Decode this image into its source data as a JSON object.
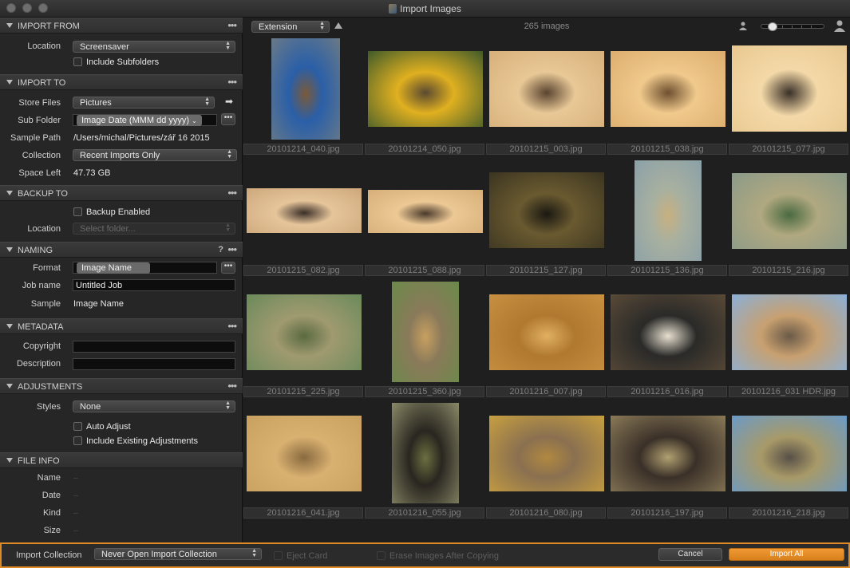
{
  "window": {
    "title": "Import Images"
  },
  "sidebar": {
    "import_from": {
      "header": "IMPORT FROM",
      "location_label": "Location",
      "location_value": "Screensaver",
      "include_subfolders": "Include Subfolders"
    },
    "import_to": {
      "header": "IMPORT TO",
      "store_files_label": "Store Files",
      "store_files_value": "Pictures",
      "sub_folder_label": "Sub Folder",
      "sub_folder_value": "Image Date (MMM dd yyyy)",
      "sample_path_label": "Sample Path",
      "sample_path_value": "/Users/michal/Pictures/zář 16 2015",
      "collection_label": "Collection",
      "collection_value": "Recent Imports Only",
      "space_left_label": "Space Left",
      "space_left_value": "47.73 GB"
    },
    "backup_to": {
      "header": "BACKUP TO",
      "backup_enabled": "Backup Enabled",
      "location_label": "Location",
      "location_placeholder": "Select folder..."
    },
    "naming": {
      "header": "NAMING",
      "help": "?",
      "format_label": "Format",
      "format_token": "Image Name",
      "job_name_label": "Job name",
      "job_name_value": "Untitled Job",
      "sample_label": "Sample",
      "sample_value": "Image Name"
    },
    "metadata": {
      "header": "METADATA",
      "copyright_label": "Copyright",
      "description_label": "Description"
    },
    "adjustments": {
      "header": "ADJUSTMENTS",
      "styles_label": "Styles",
      "styles_value": "None",
      "auto_adjust": "Auto Adjust",
      "include_existing": "Include Existing Adjustments"
    },
    "file_info": {
      "header": "FILE INFO",
      "name_label": "Name",
      "date_label": "Date",
      "kind_label": "Kind",
      "size_label": "Size"
    }
  },
  "browser": {
    "sort_value": "Extension",
    "count": "265 images",
    "thumbnails": [
      {
        "name": "20101214_040.jpg",
        "palette": [
          "#6b7a86",
          "#2a5fa8",
          "#7a5a3a"
        ]
      },
      {
        "name": "20101214_050.jpg",
        "palette": [
          "#3f5a2a",
          "#e0b020",
          "#5a4a30"
        ]
      },
      {
        "name": "20101215_003.jpg",
        "palette": [
          "#d7b07a",
          "#e8c896",
          "#5a4430"
        ]
      },
      {
        "name": "20101215_038.jpg",
        "palette": [
          "#dcae6e",
          "#f0c98c",
          "#6e5030"
        ]
      },
      {
        "name": "20101215_077.jpg",
        "palette": [
          "#e8c890",
          "#f4d9a8",
          "#3a3028"
        ]
      },
      {
        "name": "20101215_082.jpg",
        "palette": [
          "#cda77c",
          "#e6c59a",
          "#3a2e28"
        ]
      },
      {
        "name": "20101215_088.jpg",
        "palette": [
          "#d6ae78",
          "#ecc894",
          "#4a3a2c"
        ]
      },
      {
        "name": "20101215_127.jpg",
        "palette": [
          "#3a3420",
          "#6a5a30",
          "#1a1812"
        ]
      },
      {
        "name": "20101215_136.jpg",
        "palette": [
          "#8aa0a8",
          "#a8b0a0",
          "#c8b080"
        ]
      },
      {
        "name": "20101215_216.jpg",
        "palette": [
          "#8a9a88",
          "#b0a880",
          "#4a6a40"
        ]
      },
      {
        "name": "20101215_225.jpg",
        "palette": [
          "#6a8a5a",
          "#a09a70",
          "#5a6a40"
        ]
      },
      {
        "name": "20101215_360.jpg",
        "palette": [
          "#6a8a4a",
          "#8a7a5a",
          "#c8a060"
        ]
      },
      {
        "name": "20101216_007.jpg",
        "palette": [
          "#c89040",
          "#b07830",
          "#e0b060"
        ]
      },
      {
        "name": "20101216_016.jpg",
        "palette": [
          "#5a4a38",
          "#2a2a28",
          "#e8e0d0"
        ]
      },
      {
        "name": "20101216_031 HDR.jpg",
        "palette": [
          "#8ab0d8",
          "#c8a070",
          "#6a5a48"
        ]
      },
      {
        "name": "20101216_041.jpg",
        "palette": [
          "#c8a060",
          "#d8b070",
          "#8a6a40"
        ]
      },
      {
        "name": "20101216_055.jpg",
        "palette": [
          "#8a8a68",
          "#2a2620",
          "#6a7040"
        ]
      },
      {
        "name": "20101216_080.jpg",
        "palette": [
          "#c8a040",
          "#8a7050",
          "#b08840"
        ]
      },
      {
        "name": "20101216_197.jpg",
        "palette": [
          "#8a7a58",
          "#3a3028",
          "#b0a070"
        ]
      },
      {
        "name": "20101216_218.jpg",
        "palette": [
          "#6a9ac8",
          "#a89a68",
          "#585048"
        ]
      }
    ]
  },
  "bottom_bar": {
    "import_collection_label": "Import Collection",
    "import_collection_value": "Never Open Import Collection",
    "eject_card": "Eject Card",
    "erase_images": "Erase Images After Copying",
    "cancel": "Cancel",
    "import_all": "Import All"
  },
  "colors": {
    "accent": "#e08a25",
    "background": "#1c1c1c",
    "panel": "#262626"
  }
}
